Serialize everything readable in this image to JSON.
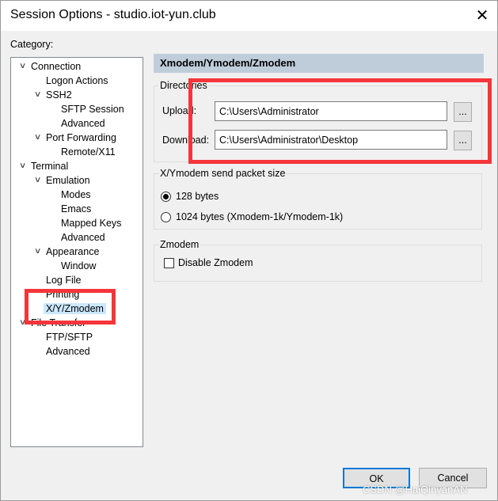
{
  "window": {
    "title": "Session Options - studio.iot-yun.club",
    "close_icon": "close-icon"
  },
  "category_label": "Category:",
  "tree": [
    {
      "label": "Connection",
      "level": 0,
      "expanded": true
    },
    {
      "label": "Logon Actions",
      "level": 1
    },
    {
      "label": "SSH2",
      "level": 1,
      "expanded": true
    },
    {
      "label": "SFTP Session",
      "level": 2
    },
    {
      "label": "Advanced",
      "level": 2
    },
    {
      "label": "Port Forwarding",
      "level": 1,
      "expanded": true
    },
    {
      "label": "Remote/X11",
      "level": 2
    },
    {
      "label": "Terminal",
      "level": 0,
      "expanded": true
    },
    {
      "label": "Emulation",
      "level": 1,
      "expanded": true
    },
    {
      "label": "Modes",
      "level": 2
    },
    {
      "label": "Emacs",
      "level": 2
    },
    {
      "label": "Mapped Keys",
      "level": 2
    },
    {
      "label": "Advanced",
      "level": 2
    },
    {
      "label": "Appearance",
      "level": 1,
      "expanded": true
    },
    {
      "label": "Window",
      "level": 2
    },
    {
      "label": "Log File",
      "level": 1
    },
    {
      "label": "Printing",
      "level": 1
    },
    {
      "label": "X/Y/Zmodem",
      "level": 1,
      "selected": true
    },
    {
      "label": "File Transfer",
      "level": 0,
      "expanded": true
    },
    {
      "label": "FTP/SFTP",
      "level": 1
    },
    {
      "label": "Advanced",
      "level": 1
    }
  ],
  "panel": {
    "header": "Xmodem/Ymodem/Zmodem",
    "directories": {
      "legend": "Directories",
      "upload_label": "Upload:",
      "upload_value": "C:\\Users\\Administrator",
      "download_label": "Download:",
      "download_value": "C:\\Users\\Administrator\\Desktop",
      "browse_label": "..."
    },
    "packet": {
      "legend": "X/Ymodem send packet size",
      "opt1": "128 bytes",
      "opt2": "1024 bytes  (Xmodem-1k/Ymodem-1k)",
      "selected": "128 bytes"
    },
    "zmodem": {
      "legend": "Zmodem",
      "disable_label": "Disable Zmodem",
      "disable_checked": false
    }
  },
  "buttons": {
    "ok": "OK",
    "cancel": "Cancel"
  },
  "watermark": "CSDN @HaiQinyanAN",
  "highlight_color": "#f4353a"
}
